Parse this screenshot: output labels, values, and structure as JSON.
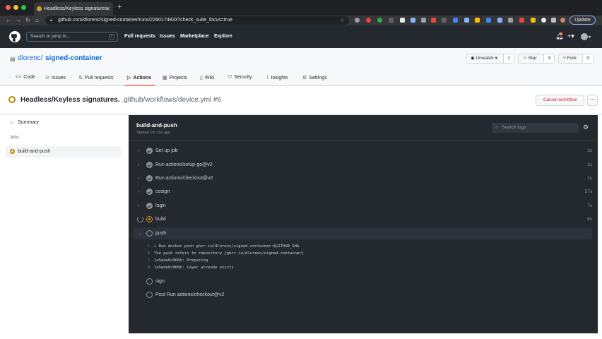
{
  "browser": {
    "tab_title": "Headless/Keyless signatures.",
    "url": "github.com/dlorenc/signed-container/runs/2260174833?check_suite_focus=true",
    "update_label": "Update"
  },
  "header": {
    "search_placeholder": "Search or jump to...",
    "search_shortcut": "/",
    "nav": [
      "Pull requests",
      "Issues",
      "Marketplace",
      "Explore"
    ]
  },
  "repo": {
    "owner": "dlorenc",
    "separator": "/",
    "name": "signed-container",
    "watch": {
      "label": "Unwatch ▾",
      "count": "1"
    },
    "star": {
      "label": "Star",
      "count": "3"
    },
    "fork": {
      "label": "Fork",
      "count": "0"
    },
    "tabs": [
      "Code",
      "Issues",
      "Pull requests",
      "Actions",
      "Projects",
      "Wiki",
      "Security",
      "Insights",
      "Settings"
    ],
    "active_tab": "Actions"
  },
  "run": {
    "title": "Headless/Keyless signatures.",
    "workflow": ".github/workflows/device.yml #6",
    "cancel_label": "Cancel workflow",
    "more_label": "···"
  },
  "sidebar": {
    "summary_label": "Summary",
    "jobs_header": "Jobs",
    "job_label": "build-and-push"
  },
  "job": {
    "title": "build-and-push",
    "started": "Started 1m 15s ago",
    "search_placeholder": "Search logs",
    "steps": [
      {
        "name": "Set up job",
        "duration": "3s",
        "status": "success"
      },
      {
        "name": "Run actions/setup-go@v2",
        "duration": "1s",
        "status": "success"
      },
      {
        "name": "Run actions/checkout@v2",
        "duration": "1s",
        "status": "success"
      },
      {
        "name": "cosign",
        "duration": "57s",
        "status": "success"
      },
      {
        "name": "login",
        "duration": "7s",
        "status": "success"
      },
      {
        "name": "build",
        "duration": "6s",
        "status": "success"
      },
      {
        "name": "push",
        "duration": "",
        "status": "in_progress"
      },
      {
        "name": "sign",
        "duration": "",
        "status": "pending"
      },
      {
        "name": "Post Run actions/checkout@v2",
        "duration": "",
        "status": "pending"
      }
    ],
    "log_lines": [
      {
        "n": "1",
        "text": "▸ Run docker push ghcr.io/dlorenc/signed-container:$GITHUB_SHA"
      },
      {
        "n": "6",
        "text": "The push refers to repository [ghcr.io/dlorenc/signed-container]"
      },
      {
        "n": "7",
        "text": "1a5ede0c966b: Preparing"
      },
      {
        "n": "8",
        "text": "1a5ede0c966b: Layer already exists"
      }
    ]
  },
  "colors": {
    "header_bg": "#24292f",
    "log_bg": "#24292f",
    "link": "#0969da",
    "running": "#d29922",
    "danger": "#cf222e",
    "tab_underline": "#fd8c73"
  }
}
